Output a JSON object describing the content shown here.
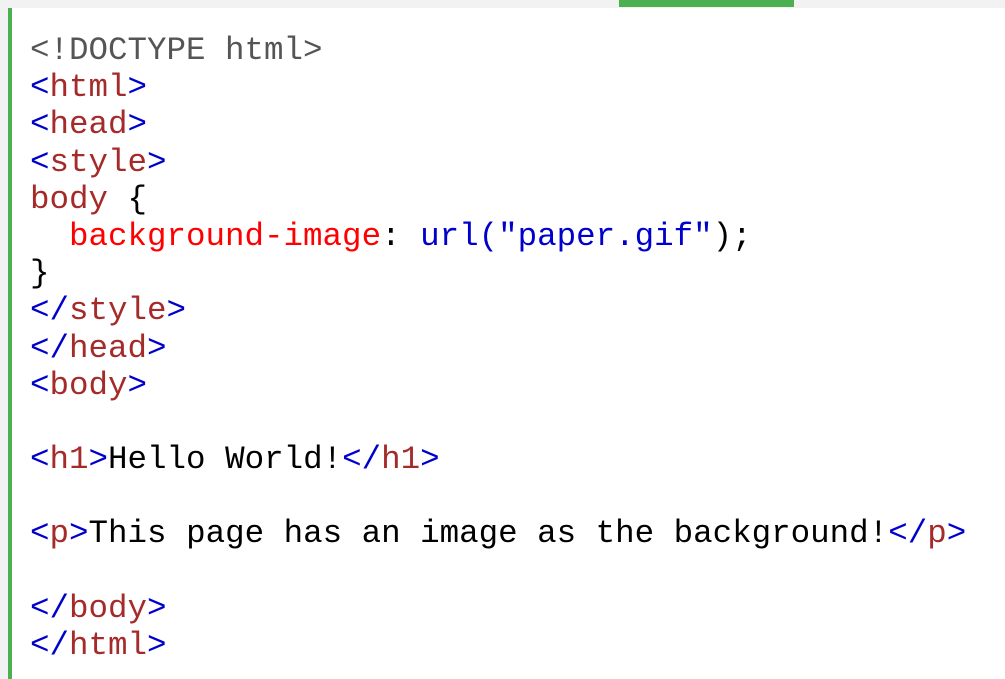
{
  "theme": {
    "accent": "#4caf50",
    "tag_color": "#a52a2a",
    "bracket_color": "#0000cd",
    "property_color": "#ff0000",
    "value_color": "#0000cd",
    "doctype_color": "#555555",
    "text_color": "#000000"
  },
  "code": {
    "lines": [
      {
        "tokens": [
          {
            "t": "gray",
            "v": "<!DOCTYPE html>"
          }
        ]
      },
      {
        "tokens": [
          {
            "t": "br",
            "v": "<"
          },
          {
            "t": "tag",
            "v": "html"
          },
          {
            "t": "br",
            "v": ">"
          }
        ]
      },
      {
        "tokens": [
          {
            "t": "br",
            "v": "<"
          },
          {
            "t": "tag",
            "v": "head"
          },
          {
            "t": "br",
            "v": ">"
          }
        ]
      },
      {
        "tokens": [
          {
            "t": "br",
            "v": "<"
          },
          {
            "t": "tag",
            "v": "style"
          },
          {
            "t": "br",
            "v": ">"
          }
        ]
      },
      {
        "tokens": [
          {
            "t": "tag",
            "v": "body"
          },
          {
            "t": "black",
            "v": " {"
          }
        ]
      },
      {
        "tokens": [
          {
            "t": "black",
            "v": "  "
          },
          {
            "t": "prop",
            "v": "background-image"
          },
          {
            "t": "black",
            "v": ": "
          },
          {
            "t": "val",
            "v": "url("
          },
          {
            "t": "val",
            "v": "\"paper.gif\""
          },
          {
            "t": "black",
            "v": ");"
          }
        ]
      },
      {
        "tokens": [
          {
            "t": "black",
            "v": "}"
          }
        ]
      },
      {
        "tokens": [
          {
            "t": "br",
            "v": "</"
          },
          {
            "t": "tag",
            "v": "style"
          },
          {
            "t": "br",
            "v": ">"
          }
        ]
      },
      {
        "tokens": [
          {
            "t": "br",
            "v": "</"
          },
          {
            "t": "tag",
            "v": "head"
          },
          {
            "t": "br",
            "v": ">"
          }
        ]
      },
      {
        "tokens": [
          {
            "t": "br",
            "v": "<"
          },
          {
            "t": "tag",
            "v": "body"
          },
          {
            "t": "br",
            "v": ">"
          }
        ]
      },
      {
        "tokens": []
      },
      {
        "tokens": [
          {
            "t": "br",
            "v": "<"
          },
          {
            "t": "tag",
            "v": "h1"
          },
          {
            "t": "br",
            "v": ">"
          },
          {
            "t": "black",
            "v": "Hello World!"
          },
          {
            "t": "br",
            "v": "</"
          },
          {
            "t": "tag",
            "v": "h1"
          },
          {
            "t": "br",
            "v": ">"
          }
        ]
      },
      {
        "tokens": []
      },
      {
        "tokens": [
          {
            "t": "br",
            "v": "<"
          },
          {
            "t": "tag",
            "v": "p"
          },
          {
            "t": "br",
            "v": ">"
          },
          {
            "t": "black",
            "v": "This page has an image as the background!"
          },
          {
            "t": "br",
            "v": "</"
          },
          {
            "t": "tag",
            "v": "p"
          },
          {
            "t": "br",
            "v": ">"
          }
        ]
      },
      {
        "tokens": []
      },
      {
        "tokens": [
          {
            "t": "br",
            "v": "</"
          },
          {
            "t": "tag",
            "v": "body"
          },
          {
            "t": "br",
            "v": ">"
          }
        ]
      },
      {
        "tokens": [
          {
            "t": "br",
            "v": "</"
          },
          {
            "t": "tag",
            "v": "html"
          },
          {
            "t": "br",
            "v": ">"
          }
        ]
      }
    ]
  }
}
